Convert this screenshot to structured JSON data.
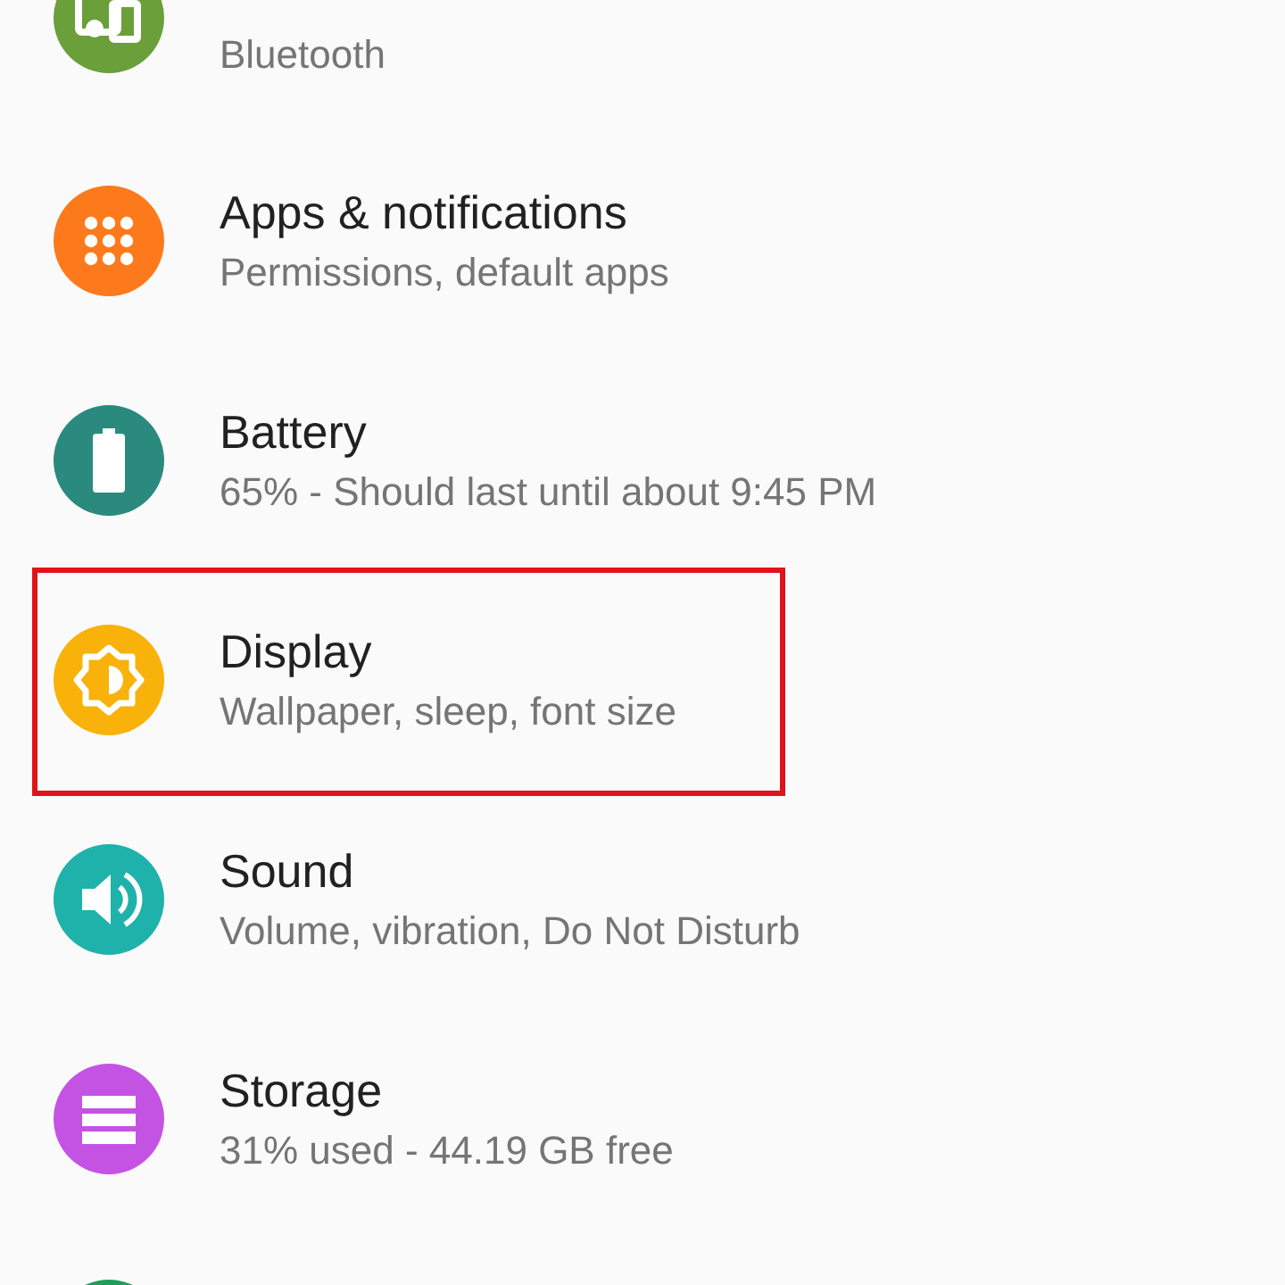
{
  "settings_list": [
    {
      "color": "#6a9f3a",
      "subtitle": "Bluetooth",
      "highlighted": false
    },
    {
      "color": "#fd7a1c",
      "title": "Apps & notifications",
      "subtitle": "Permissions, default apps",
      "highlighted": false
    },
    {
      "color": "#2a8a7e",
      "title": "Battery",
      "subtitle": "65% - Should last until about 9:45 PM",
      "highlighted": false
    },
    {
      "color": "#f8b20a",
      "title": "Display",
      "subtitle": "Wallpaper, sleep, font size",
      "highlighted": true
    },
    {
      "color": "#1eb2ab",
      "title": "Sound",
      "subtitle": "Volume, vibration, Do Not Disturb",
      "highlighted": false
    },
    {
      "color": "#c453e3",
      "title": "Storage",
      "subtitle": "31% used - 44.19 GB free",
      "highlighted": false
    },
    {
      "color": "#1f9d5a",
      "highlighted": false
    }
  ]
}
